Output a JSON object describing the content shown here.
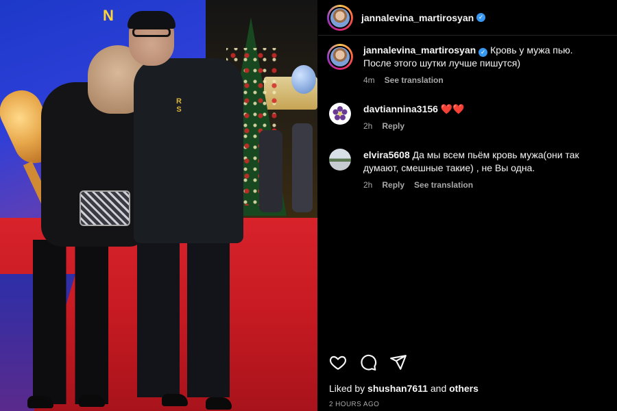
{
  "post": {
    "username": "jannalevina_martirosyan",
    "verified": true
  },
  "caption": {
    "username": "jannalevina_martirosyan",
    "text": "Кровь у мужа пью. После этого шутки лучше пишутся)",
    "age": "4m",
    "see_translation": "See translation"
  },
  "comments": [
    {
      "username": "davtiannina3156",
      "text": "❤️❤️",
      "age": "2h",
      "reply": "Reply"
    },
    {
      "username": "elvira5608",
      "text": "Да мы всем пьём кровь мужа(они так думают, смешные такие) , не Вы одна.",
      "age": "2h",
      "reply": "Reply",
      "see_translation": "See translation"
    }
  ],
  "actions": {
    "like_icon": "heart-icon",
    "comment_icon": "comment-icon",
    "share_icon": "share-icon"
  },
  "likes": {
    "prefix": "Liked by",
    "user": "shushan7611",
    "joiner": "and",
    "others": "others"
  },
  "timestamp": "2 HOURS AGO",
  "media": {
    "backdrop_text": "N",
    "shirt_logo": "R\nS"
  },
  "colors": {
    "background": "#000000",
    "text": "#f5f5f5",
    "secondary": "#a8a8a8",
    "verified": "#3897f0",
    "carpet": "#c61a22"
  }
}
